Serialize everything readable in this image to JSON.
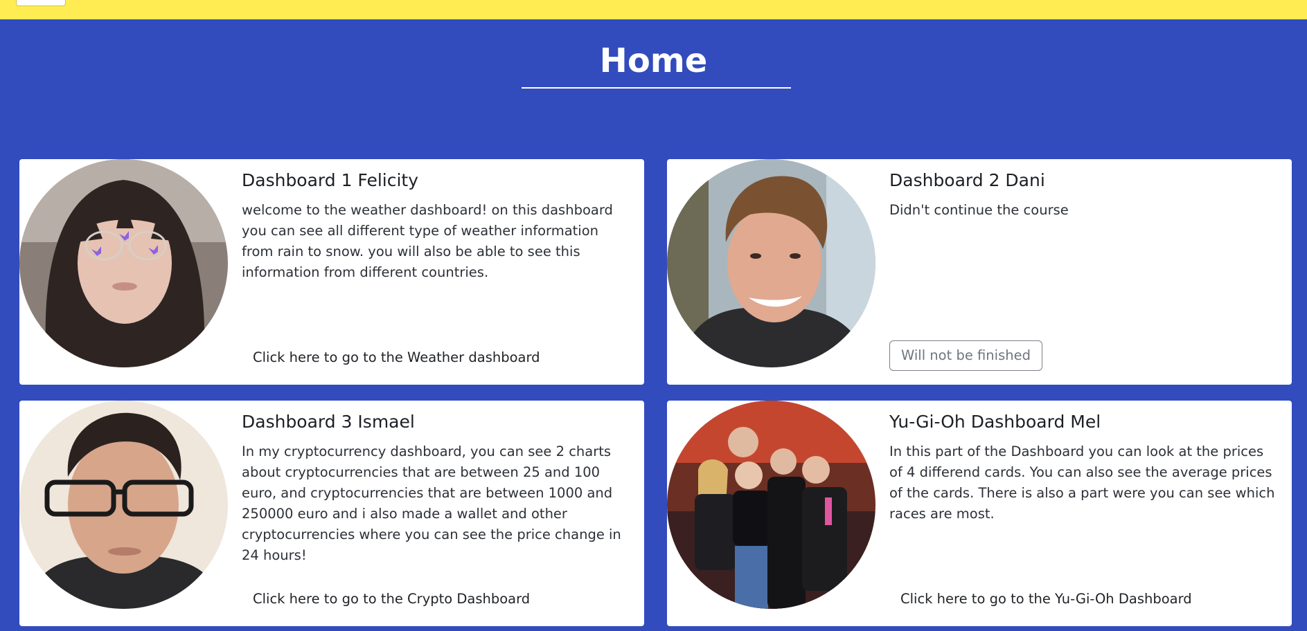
{
  "page": {
    "title": "Home"
  },
  "colors": {
    "topbar": "#ffec52",
    "background": "#324cbd",
    "card": "#ffffff"
  },
  "cards": [
    {
      "title": "Dashboard 1 Felicity",
      "text": "welcome to the weather dashboard! on this dashboard you can see all different type of weather information from rain to snow. you will also be able to see this information from different countries.",
      "link": "Click here to go to the Weather dashboard"
    },
    {
      "title": "Dashboard 2 Dani",
      "text": "Didn't continue the course",
      "button": "Will not be finished"
    },
    {
      "title": "Dashboard 3 Ismael",
      "text": "In my cryptocurrency dashboard, you can see 2 charts about cryptocurrencies that are between 25 and 100 euro, and cryptocurrencies that are between 1000 and 250000 euro and i also made a wallet and other cryptocurrencies where you can see the price change in 24 hours!",
      "link": "Click here to go to the Crypto Dashboard"
    },
    {
      "title": "Yu-Gi-Oh Dashboard Mel",
      "text": "In this part of the Dashboard you can look at the prices of 4 differend cards. You can also see the average prices of the cards. There is also a part were you can see which races are most.",
      "link": "Click here to go to the Yu-Gi-Oh Dashboard"
    }
  ]
}
